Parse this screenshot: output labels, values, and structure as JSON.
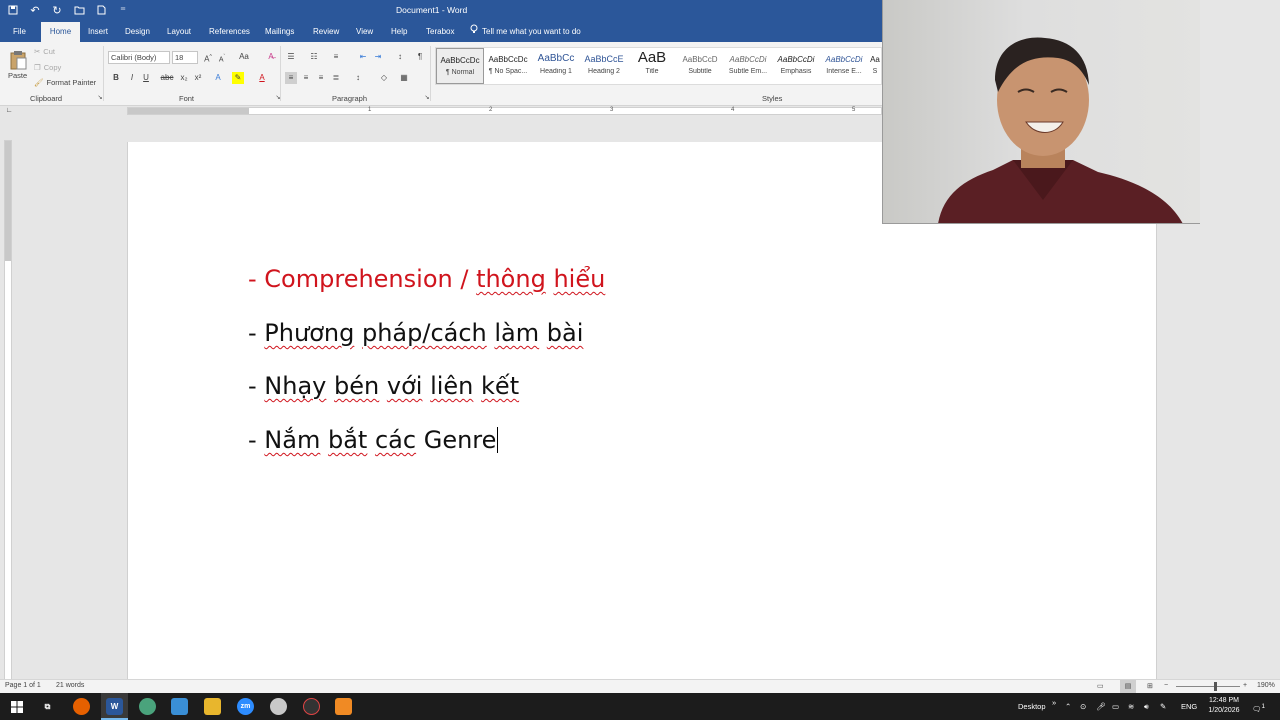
{
  "window": {
    "title": "Document1 - Word",
    "quick_access": [
      "save-icon",
      "undo-icon",
      "redo-icon",
      "open-icon",
      "new-icon",
      "customize-icon"
    ]
  },
  "tabs": [
    {
      "label": "File"
    },
    {
      "label": "Home"
    },
    {
      "label": "Insert"
    },
    {
      "label": "Design"
    },
    {
      "label": "Layout"
    },
    {
      "label": "References"
    },
    {
      "label": "Mailings"
    },
    {
      "label": "Review"
    },
    {
      "label": "View"
    },
    {
      "label": "Help"
    },
    {
      "label": "Terabox"
    }
  ],
  "tell_me": "Tell me what you want to do",
  "clipboard": {
    "paste": "Paste",
    "cut": "Cut",
    "copy": "Copy",
    "format_painter": "Format Painter",
    "label": "Clipboard"
  },
  "font": {
    "name": "Calibri (Body)",
    "size": "18",
    "label": "Font"
  },
  "paragraph": {
    "label": "Paragraph"
  },
  "styles": {
    "label": "Styles",
    "items": [
      {
        "preview": "AaBbCcDc",
        "name": "¶ Normal"
      },
      {
        "preview": "AaBbCcDc",
        "name": "¶ No Spac..."
      },
      {
        "preview": "AaBbCc",
        "name": "Heading 1"
      },
      {
        "preview": "AaBbCcE",
        "name": "Heading 2"
      },
      {
        "preview": "AaB",
        "name": "Title"
      },
      {
        "preview": "AaBbCcD",
        "name": "Subtitle"
      },
      {
        "preview": "AaBbCcDi",
        "name": "Subtle Em..."
      },
      {
        "preview": "AaBbCcDi",
        "name": "Emphasis"
      },
      {
        "preview": "AaBbCcDi",
        "name": "Intense E..."
      },
      {
        "preview": "Aa",
        "name": "S"
      }
    ]
  },
  "ruler": {
    "numbers": [
      "1",
      "1",
      "2",
      "3",
      "4",
      "5"
    ]
  },
  "document": {
    "lines": [
      {
        "prefix": "- ",
        "words": [
          "Comprehension",
          " / ",
          "thông",
          " ",
          "hiểu"
        ],
        "color": "#d0141d"
      },
      {
        "prefix": "- ",
        "words": [
          "Phương",
          " ",
          "pháp/cách",
          " ",
          "làm",
          " ",
          "bài"
        ],
        "color": "#111111"
      },
      {
        "prefix": "- ",
        "words": [
          "Nhạy",
          " ",
          "bén",
          " ",
          "với",
          " ",
          "liên",
          " ",
          "kết"
        ],
        "color": "#111111"
      },
      {
        "prefix": "- ",
        "words": [
          "Nắm",
          " ",
          "bắt",
          " ",
          "các",
          " Genre"
        ],
        "color": "#111111"
      }
    ]
  },
  "status": {
    "page": "Page 1 of 1",
    "words": "21 words",
    "zoom": "190%"
  },
  "taskbar": {
    "desktop": "Desktop",
    "lang": "ENG",
    "time": "12:48 PM",
    "date": "1/20/2026",
    "notifications": "1"
  },
  "colors": {
    "title_bar": "#2b579a",
    "highlight_red": "#d0141d"
  }
}
